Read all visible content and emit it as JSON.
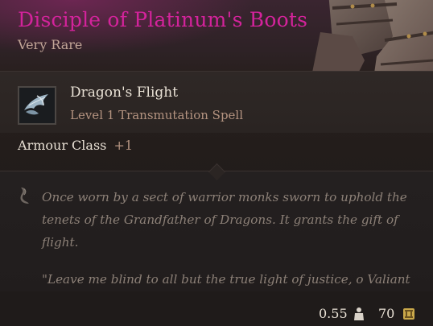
{
  "item": {
    "name": "Disciple of Platinum's Boots",
    "rarity": "Very Rare",
    "icon": "boots-art"
  },
  "spell": {
    "name": "Dragon's Flight",
    "subtitle": "Level 1 Transmutation Spell",
    "icon": "dragon-wing-spell-icon"
  },
  "stats": {
    "armour_class_label": "Armour Class",
    "armour_class_value": "+1"
  },
  "lore": {
    "text": "Once worn by a sect of warrior monks sworn to uphold the tenets of the Grandfather of Dragons. It grants the gift of flight.",
    "quote": "\"Leave me blind to all but the true light of justice, o Valiant One\"."
  },
  "footer": {
    "weight": "0.55",
    "weight_icon": "weight-icon",
    "price": "70",
    "price_icon": "gold-coin-icon"
  },
  "colors": {
    "title": "#d3239b",
    "rarity": "#c2a597",
    "text": "#e9e1d5",
    "muted": "#b49380",
    "lore": "#8c8077"
  }
}
